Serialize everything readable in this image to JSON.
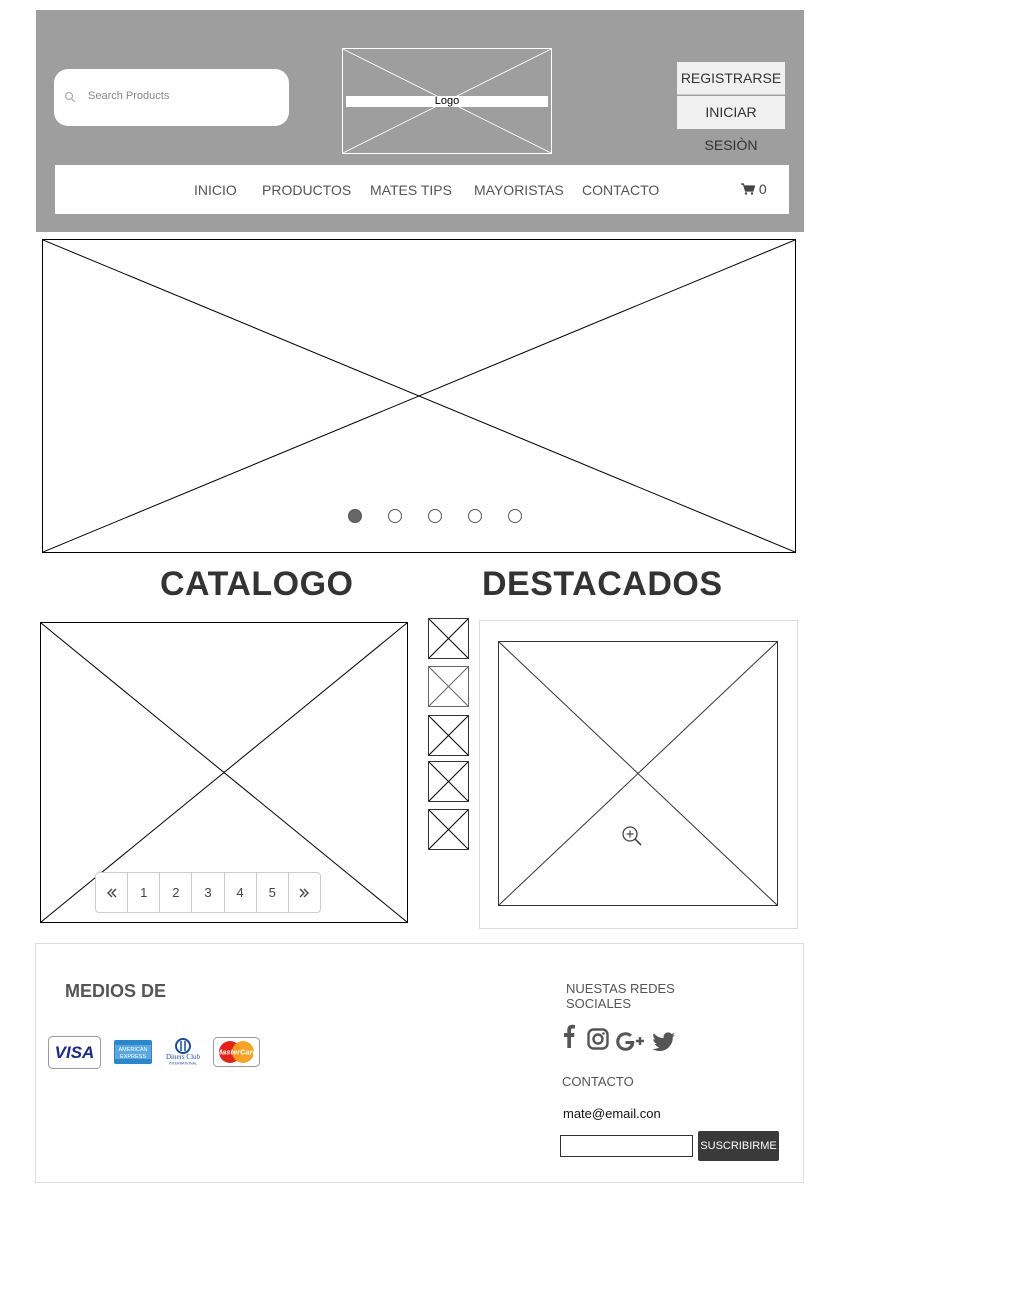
{
  "header": {
    "search_placeholder": "Search Products",
    "logo_label": "Logo",
    "register_label": "REGISTRARSE",
    "login_label": "INICIAR SESIÒN"
  },
  "nav": {
    "items": [
      "INICIO",
      "PRODUCTOS",
      "MATES TIPS",
      "MAYORISTAS",
      "CONTACTO"
    ],
    "cart_count": "0"
  },
  "hero": {
    "slides": 5,
    "active_slide": 1
  },
  "sections": {
    "catalog_title": "CATALOGO",
    "featured_title": "DESTACADOS"
  },
  "pagination": {
    "pages": [
      "1",
      "2",
      "3",
      "4",
      "5"
    ],
    "prev_icon": "double-chevron-left",
    "next_icon": "double-chevron-right"
  },
  "footer": {
    "payment_title": "MEDIOS DE",
    "cards": [
      {
        "label": "VISA",
        "icon": "visa-card"
      },
      {
        "label": "AMERICAN EXPRESS",
        "icon": "amex-card"
      },
      {
        "label": "Diners Club",
        "icon": "diners-card"
      },
      {
        "label": "MasterCard",
        "icon": "mastercard-card"
      }
    ],
    "social_title": "NUESTAS REDES SOCIALES",
    "social_icons": [
      "facebook-icon",
      "instagram-icon",
      "google-plus-icon",
      "twitter-icon"
    ],
    "contact_title": "CONTACTO",
    "email": "mate@email.con",
    "subscribe_label": "SUSCRIBIRME"
  },
  "colors": {
    "header_bg": "#9e9e9e",
    "button_dark": "#3a3a3a"
  }
}
